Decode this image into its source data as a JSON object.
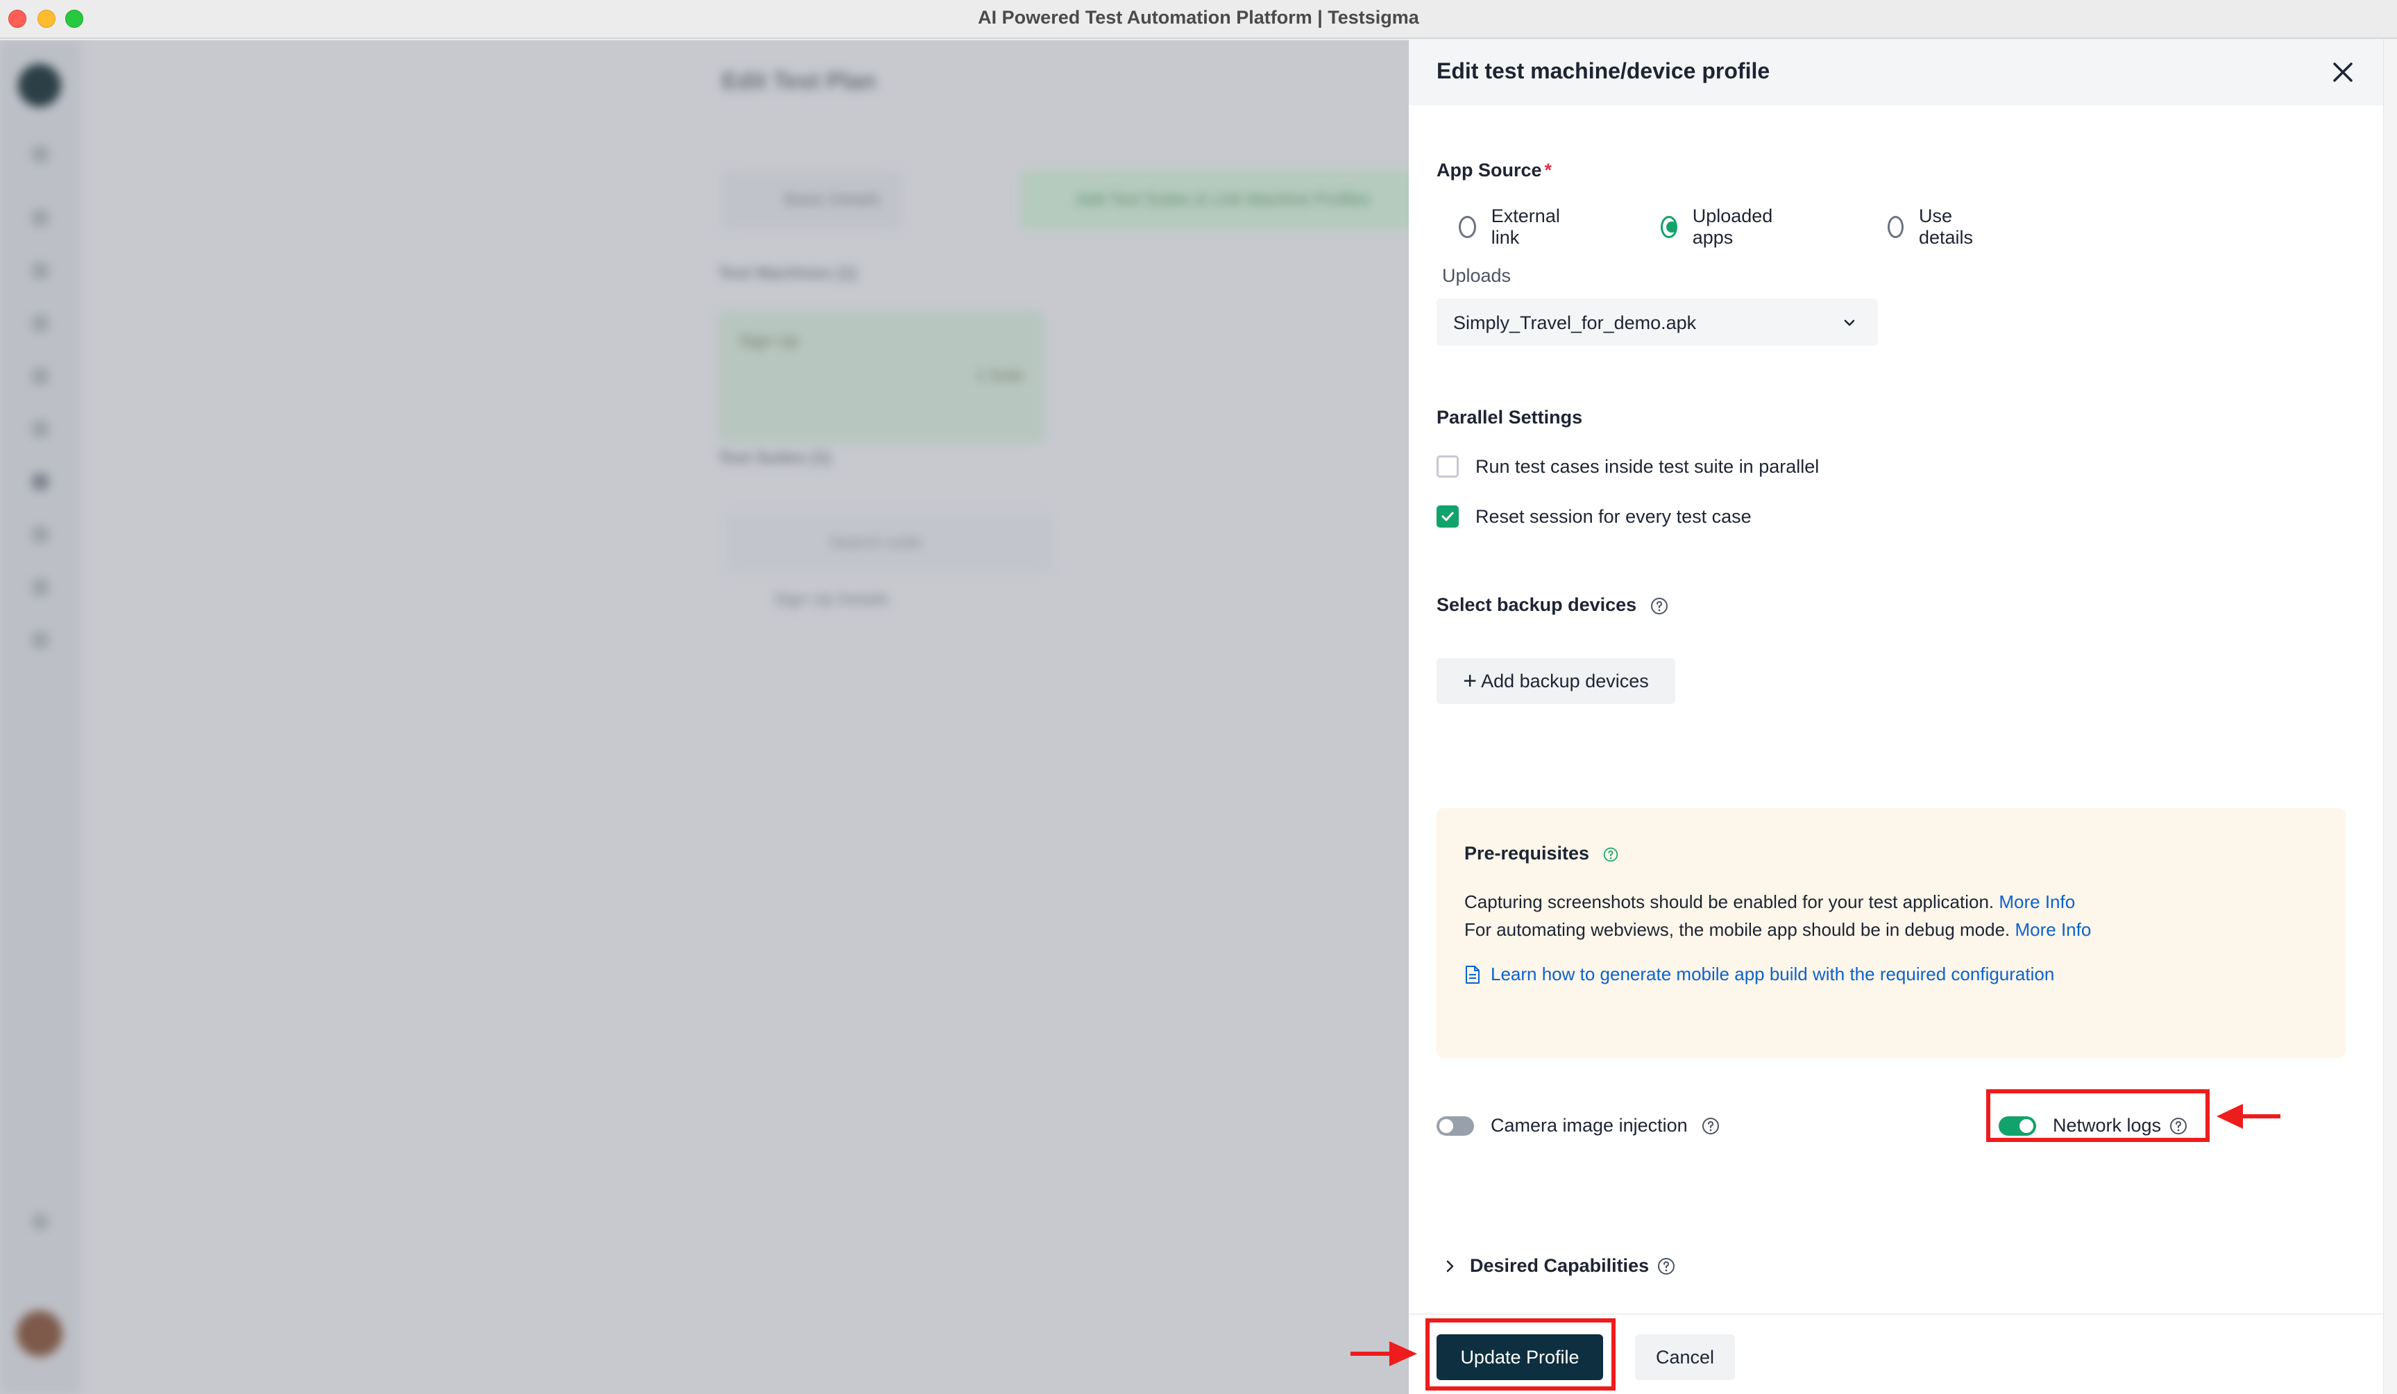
{
  "window": {
    "title": "AI Powered Test Automation Platform | Testsigma"
  },
  "background": {
    "page_heading": "Edit Test Plan",
    "back_button": "Basic Details",
    "next_button": "Add Test Suites & Link Machine Profiles",
    "machines_label": "Test Machines (1)",
    "machine_card_title": "Sign Up",
    "machine_card_meta": "1 Suite",
    "suites_label": "Test Suites (1)",
    "search_placeholder": "Search suite",
    "suite_row": "Sign Up Details"
  },
  "drawer": {
    "title": "Edit test machine/device profile",
    "app_source": {
      "label": "App Source",
      "required_mark": "*",
      "options": [
        {
          "label": "External link",
          "checked": false
        },
        {
          "label": "Uploaded apps",
          "checked": true
        },
        {
          "label": "Use details",
          "checked": false
        }
      ]
    },
    "uploads": {
      "label": "Uploads",
      "value": "Simply_Travel_for_demo.apk"
    },
    "parallel": {
      "label": "Parallel Settings",
      "options": [
        {
          "label": "Run test cases inside test suite in parallel",
          "checked": false
        },
        {
          "label": "Reset session for every test case",
          "checked": true
        }
      ]
    },
    "backup": {
      "label": "Select backup devices",
      "button": "Add backup devices"
    },
    "prerequisites": {
      "title": "Pre-requisites",
      "line1": "Capturing screenshots should be enabled for your test application.",
      "line1_link": "More Info",
      "line2": "For automating webviews, the mobile app should be in debug mode.",
      "line2_link": "More Info",
      "learn_link": "Learn how to generate mobile app build with the required configuration"
    },
    "toggles": {
      "camera": {
        "label": "Camera image injection",
        "on": false
      },
      "network": {
        "label": "Network logs",
        "on": true
      }
    },
    "desired_capabilities": "Desired Capabilities",
    "footer": {
      "update": "Update Profile",
      "cancel": "Cancel"
    }
  },
  "colors": {
    "accent_green": "#11a36b",
    "primary_dark": "#0d2f3f",
    "link_blue": "#0b63ce",
    "annotation_red": "#ee1c1c"
  }
}
